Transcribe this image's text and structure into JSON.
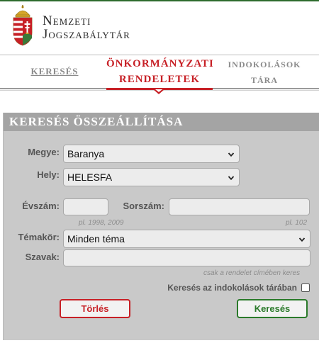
{
  "brand": {
    "line1": "Nemzeti",
    "line2": "Jogszabálytár"
  },
  "nav": {
    "search": "KERESÉS",
    "active_line1": "ÖNKORMÁNYZATI",
    "active_line2": "RENDELETEK",
    "reasons_line1": "INDOKOLÁSOK",
    "reasons_line2": "TÁRA"
  },
  "form": {
    "title": "KERESÉS ÖSSZEÁLLÍTÁSA",
    "county_label": "Megye:",
    "county_value": "Baranya",
    "place_label": "Hely:",
    "place_value": "HELESFA",
    "year_label": "Évszám:",
    "year_hint": "pl. 1998, 2009",
    "number_label": "Sorszám:",
    "number_hint": "pl. 102",
    "topic_label": "Témakör:",
    "topic_value": "Minden téma",
    "words_label": "Szavak:",
    "words_hint": "csak a rendelet címében keres",
    "reasons_checkbox_label": "Keresés az indokolások tárában",
    "clear_button": "Törlés",
    "search_button": "Keresés"
  },
  "colors": {
    "accent_red": "#c72026",
    "accent_green": "#2a7a2a",
    "panel_bg": "#c9c9c9",
    "title_bar": "#a4a4a4"
  },
  "icons": {
    "crest": "hungarian-coat-of-arms-icon",
    "dropdown": "chevron-down-icon"
  }
}
